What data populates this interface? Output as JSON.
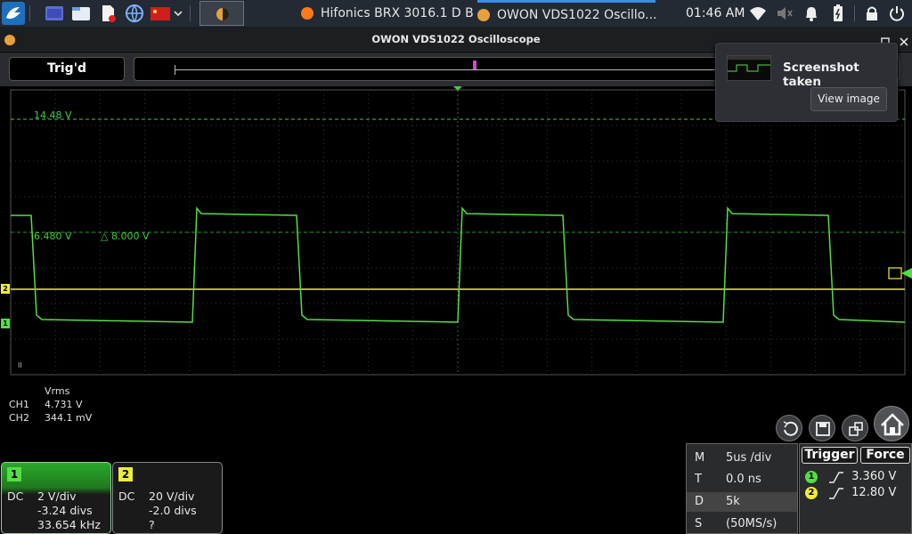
{
  "taskbar": {
    "tasks": [
      {
        "label": "Hifonics BRX 3016.1 D B...",
        "icon": "firefox-icon"
      },
      {
        "label": "OWON VDS1022 Oscillo...",
        "icon": "owon-app-icon"
      }
    ],
    "clock": "01:46 AM"
  },
  "window": {
    "title": "OWON VDS1022 Oscilloscope"
  },
  "scope": {
    "trigger_status": "Trig'd",
    "markers": {
      "upper_level": "14.48 V",
      "lower_level": "6.480 V",
      "delta": "△ 8.000 V",
      "ch2_marker": "2",
      "ch1_marker": "1",
      "corner": "II"
    },
    "colors": {
      "ch1": "#55dd44",
      "ch2": "#eeee33",
      "cursor_green": "#44cc44",
      "grid": "#3a3a3a"
    }
  },
  "measurements": {
    "header": "Vrms",
    "rows": [
      {
        "label": "CH1",
        "value": "4.731 V"
      },
      {
        "label": "CH2",
        "value": "344.1 mV"
      }
    ]
  },
  "channels": [
    {
      "num": "1",
      "coupling": "DC",
      "scale": "2 V/div",
      "offset": "-3.24 divs",
      "freq": "33.654 kHz"
    },
    {
      "num": "2",
      "coupling": "DC",
      "scale": "20 V/div",
      "offset": "-2.0 divs",
      "freq": "?"
    }
  ],
  "timebase": [
    {
      "key": "M",
      "value": "5us /div"
    },
    {
      "key": "T",
      "value": "0.0 ns"
    },
    {
      "key": "D",
      "value": "5k"
    },
    {
      "key": "S",
      "value": "(50MS/s)"
    }
  ],
  "trigger": {
    "trigger_label": "Trigger",
    "force_label": "Force",
    "levels": [
      {
        "ch": "1",
        "value": "3.360 V"
      },
      {
        "ch": "2",
        "value": "12.80 V"
      }
    ]
  },
  "notification": {
    "title": "Screenshot taken",
    "button": "View image"
  },
  "icons": [
    "launcher-icon",
    "files-icon",
    "folder-icon",
    "document-icon",
    "globe-icon",
    "flag-icon",
    "chevron-down-icon",
    "wifi-icon",
    "volume-icon",
    "bell-icon",
    "battery-icon",
    "lock-icon",
    "power-icon",
    "maximize-icon",
    "close-icon",
    "undo-icon",
    "save-icon",
    "export-icon",
    "home-icon"
  ]
}
